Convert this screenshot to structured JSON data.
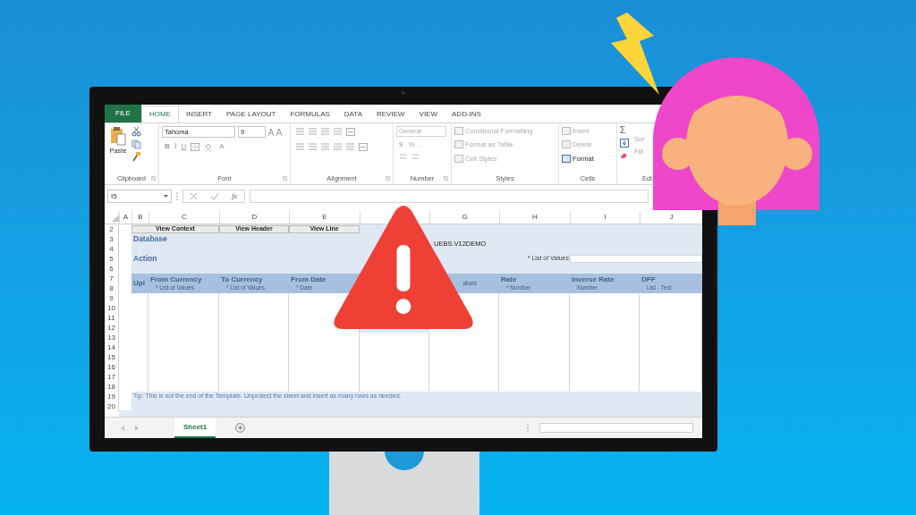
{
  "ribbon": {
    "tabs": [
      {
        "label": "FILE",
        "kind": "file",
        "selected": false
      },
      {
        "label": "HOME",
        "kind": "tab",
        "selected": true
      },
      {
        "label": "INSERT",
        "kind": "tab",
        "selected": false
      },
      {
        "label": "PAGE LAYOUT",
        "kind": "tab",
        "selected": false
      },
      {
        "label": "FORMULAS",
        "kind": "tab",
        "selected": false
      },
      {
        "label": "DATA",
        "kind": "tab",
        "selected": false
      },
      {
        "label": "REVIEW",
        "kind": "tab",
        "selected": false
      },
      {
        "label": "VIEW",
        "kind": "tab",
        "selected": false
      },
      {
        "label": "ADD-INS",
        "kind": "tab",
        "selected": false
      }
    ],
    "clipboard": {
      "paste": "Paste",
      "label": "Clipboard"
    },
    "font": {
      "family": "Tahoma",
      "size": "9",
      "bold": "B",
      "italic": "I",
      "underline": "U",
      "color_button": "A",
      "label": "Font"
    },
    "alignment": {
      "label": "Alignment"
    },
    "number": {
      "format": "General",
      "currency": "$",
      "percent": "%",
      "comma": ",",
      "label": "Number"
    },
    "styles": {
      "items": [
        {
          "label": "Conditional Formatting",
          "disabled": true
        },
        {
          "label": "Format as Table",
          "disabled": true
        },
        {
          "label": "Cell Styles",
          "disabled": true
        }
      ],
      "label": "Styles"
    },
    "cells": {
      "items": [
        {
          "label": "Insert",
          "disabled": true
        },
        {
          "label": "Delete",
          "disabled": true
        },
        {
          "label": "Format",
          "disabled": false
        }
      ],
      "label": "Cells"
    },
    "editing": {
      "sum": "Σ",
      "sort": "Sor",
      "filter": "Filt",
      "label": "Edi"
    }
  },
  "formula_bar": {
    "name_box": "I5",
    "function_label": "fx"
  },
  "sheet": {
    "columns": [
      {
        "letter": "A"
      },
      {
        "letter": "B"
      },
      {
        "letter": "C"
      },
      {
        "letter": "D"
      },
      {
        "letter": "E"
      },
      {},
      {
        "letter": "G"
      },
      {
        "letter": "H"
      },
      {
        "letter": "I"
      },
      {
        "letter": "J"
      }
    ],
    "rows": [
      "2",
      "3",
      "4",
      "5",
      "6",
      "7",
      "8",
      "9",
      "10",
      "11",
      "12",
      "13",
      "14",
      "15",
      "16",
      "17",
      "18",
      "19",
      "20"
    ],
    "buttons": [
      "View Context",
      "View Header",
      "View Line"
    ],
    "database_label": "Database",
    "database_value": "UEBS.V12DEMO",
    "action_label": "Action",
    "action_hint": "* List of Values",
    "headers": [
      {
        "title": "Upl"
      },
      {
        "title": "From Currency",
        "sub": "* List of Values"
      },
      {
        "title": "To Currency",
        "sub": "* List of Values"
      },
      {
        "title": "From Date",
        "sub": "* Date"
      },
      {
        "sub": "alues"
      },
      {
        "title": "Rate",
        "sub": "* Number"
      },
      {
        "title": "Inverse Rate",
        "sub": "Number"
      },
      {
        "title": "DFF",
        "sub": "List - Text"
      }
    ],
    "tip": "Tip:  This is not the end of the Template.  Unprotect the sheet and insert as many rows as needed."
  },
  "sheet_tabs": [
    {
      "label": "Sheet1",
      "selected": true
    }
  ]
}
